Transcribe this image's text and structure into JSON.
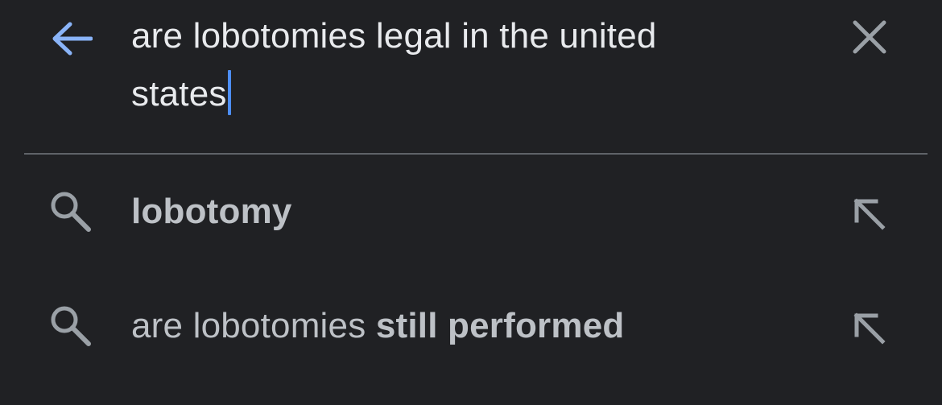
{
  "search": {
    "query_line1": "are lobotomies legal in the united",
    "query_line2": "states",
    "back_icon": "arrow-back-icon",
    "clear_icon": "close-icon",
    "cursor_color": "#4d8ef7",
    "back_icon_color": "#8ab4f8"
  },
  "suggestions": [
    {
      "prefix": "",
      "bold": "lobotomy",
      "icon": "search-icon",
      "action_icon": "arrow-up-left-icon"
    },
    {
      "prefix": "are lobotomies ",
      "bold": "still performed",
      "icon": "search-icon",
      "action_icon": "arrow-up-left-icon"
    }
  ],
  "colors": {
    "background": "#202124",
    "text_primary": "#e8eaed",
    "text_secondary": "#bdc1c6",
    "icon_gray": "#9aa0a6",
    "divider": "#5f6368"
  }
}
